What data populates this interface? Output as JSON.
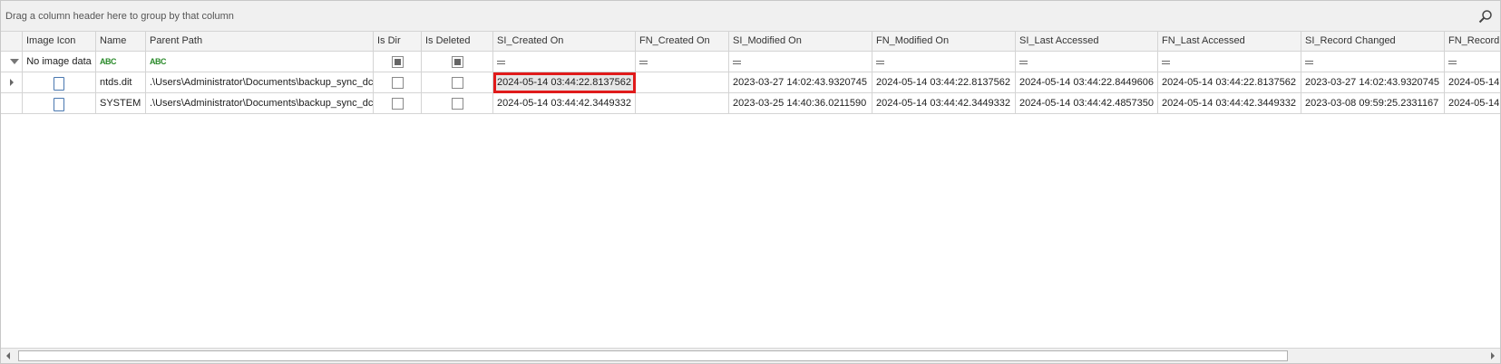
{
  "group_panel": {
    "hint": "Drag a column header here to group by that column",
    "search_icon": "search-icon"
  },
  "columns": [
    "Image Icon",
    "Name",
    "Parent Path",
    "Is Dir",
    "Is Deleted",
    "SI_Created On",
    "FN_Created On",
    "SI_Modified On",
    "FN_Modified On",
    "SI_Last Accessed",
    "FN_Last Accessed",
    "SI_Record Changed",
    "FN_Record"
  ],
  "filter_row": {
    "image_icon": "No image data",
    "name_op": "ABC",
    "parent_path_op": "ABC"
  },
  "rows": [
    {
      "name": "ntds.dit",
      "parent_path": ".\\Users\\Administrator\\Documents\\backup_sync_dc",
      "si_created_on": "2024-05-14 03:44:22.8137562",
      "fn_created_on": "",
      "si_modified_on": "2023-03-27 14:02:43.9320745",
      "fn_modified_on": "2024-05-14 03:44:22.8137562",
      "si_last_accessed": "2024-05-14 03:44:22.8449606",
      "fn_last_accessed": "2024-05-14 03:44:22.8137562",
      "si_record_changed": "2023-03-27 14:02:43.9320745",
      "fn_record": "2024-05-14"
    },
    {
      "name": "SYSTEM",
      "parent_path": ".\\Users\\Administrator\\Documents\\backup_sync_dc",
      "si_created_on": "2024-05-14 03:44:42.3449332",
      "fn_created_on": "",
      "si_modified_on": "2023-03-25 14:40:36.0211590",
      "fn_modified_on": "2024-05-14 03:44:42.3449332",
      "si_last_accessed": "2024-05-14 03:44:42.4857350",
      "fn_last_accessed": "2024-05-14 03:44:42.3449332",
      "si_record_changed": "2023-03-08 09:59:25.2331167",
      "fn_record": "2024-05-14"
    }
  ],
  "colors": {
    "highlight": "#e01b1b",
    "abc": "#2a8a2a"
  }
}
